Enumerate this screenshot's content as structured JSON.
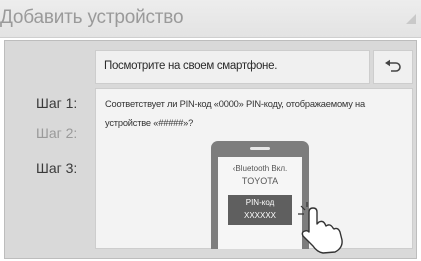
{
  "title": "Добавить устройство",
  "instruction": "Посмотрите на своем смартфоне.",
  "steps": [
    {
      "label": "Шаг 1:",
      "state": "active"
    },
    {
      "label": "Шаг 2:",
      "state": "inactive"
    },
    {
      "label": "Шаг 3:",
      "state": "active"
    }
  ],
  "question": "Соответствует ли PIN-код «0000» PIN-коду, отображаемому на устройстве «#####»?",
  "phone": {
    "bluetooth_label": "‹Bluetooth Вкл.",
    "device_name": "TOYOTA",
    "pin_label": "PIN-код",
    "pin_value": "XXXXXX"
  },
  "icons": {
    "back": "back-arrow-icon",
    "signal": "signal-icon",
    "hand": "tap-hand-icon"
  },
  "colors": {
    "title_text": "#9a9a9a",
    "panel": "#d9d9d9",
    "phone_body": "#7d7d7d",
    "pin_box": "#5f5f5f"
  }
}
